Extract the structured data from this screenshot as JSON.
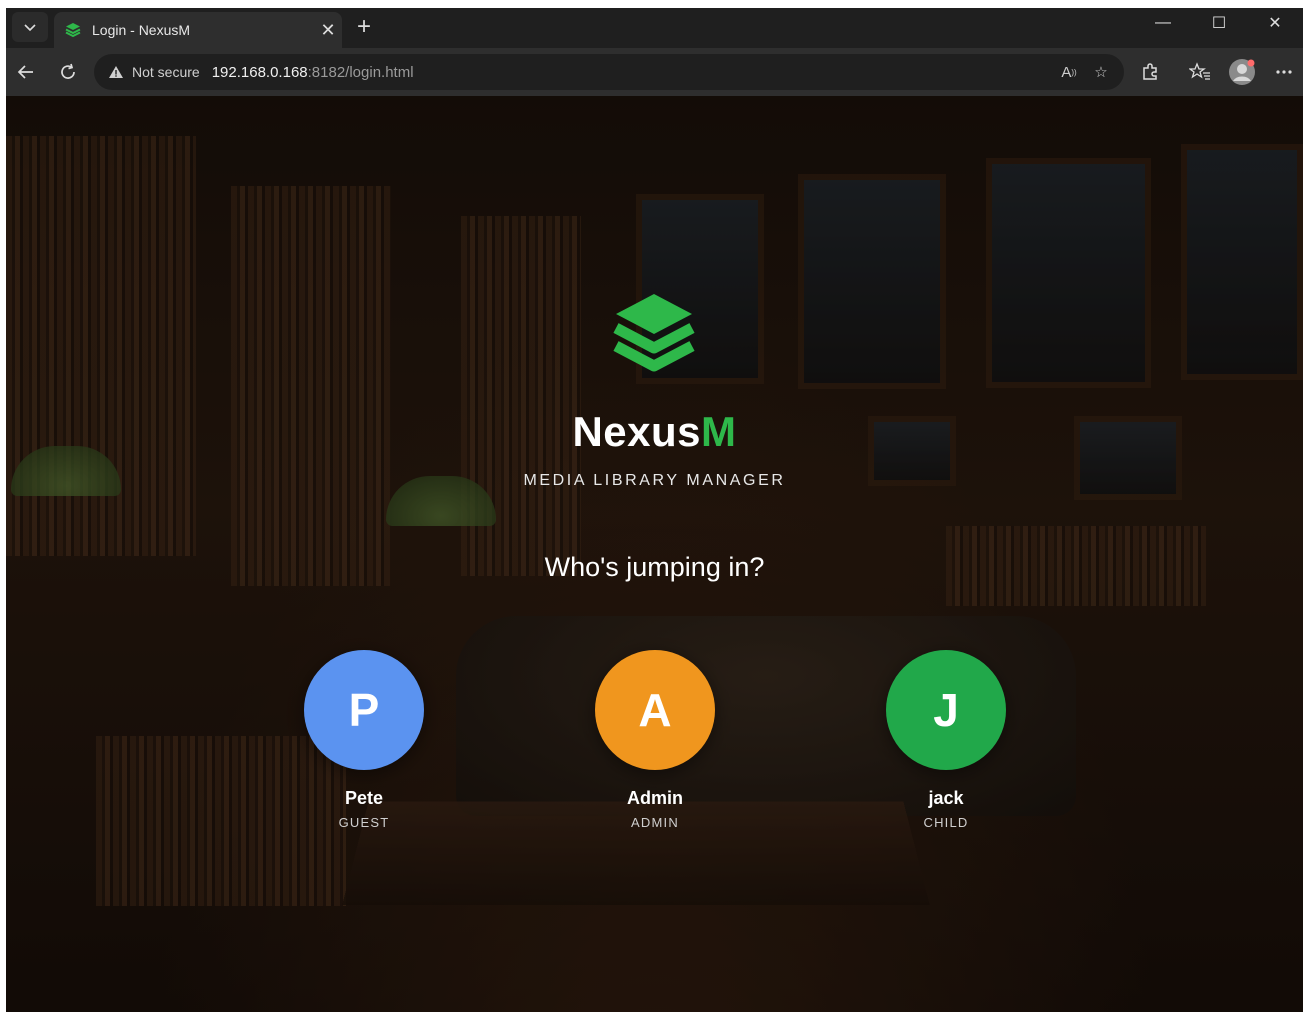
{
  "browser": {
    "tab_title": "Login - NexusM",
    "security_label": "Not secure",
    "url_host": "192.168.0.168",
    "url_rest": ":8182/login.html"
  },
  "app": {
    "brand_main": "Nexus",
    "brand_accent": "M",
    "tagline": "MEDIA LIBRARY MANAGER",
    "question": "Who's jumping in?",
    "accent_color": "#2eb84a"
  },
  "profiles": [
    {
      "initial": "P",
      "name": "Pete",
      "role": "GUEST",
      "color": "#5b93f0"
    },
    {
      "initial": "A",
      "name": "Admin",
      "role": "ADMIN",
      "color": "#f0961e"
    },
    {
      "initial": "J",
      "name": "jack",
      "role": "CHILD",
      "color": "#21a84a"
    }
  ]
}
